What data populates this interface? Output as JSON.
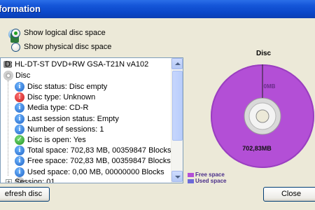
{
  "window": {
    "title": "formation"
  },
  "view_options": [
    {
      "label": "Show logical disc space",
      "checked": true
    },
    {
      "label": "Show physical disc space",
      "checked": false
    }
  ],
  "tree": {
    "drive": "D:  HL-DT-ST  DVD+RW GSA-T21N  vA102",
    "disc": "Disc",
    "items": [
      {
        "icon": "info",
        "text": "Disc status: Disc empty"
      },
      {
        "icon": "warn",
        "text": "Disc type: Unknown"
      },
      {
        "icon": "info",
        "text": "Media type: CD-R"
      },
      {
        "icon": "info",
        "text": "Last session status: Empty"
      },
      {
        "icon": "info",
        "text": "Number of sessions: 1"
      },
      {
        "icon": "ok",
        "text": "Disc is open: Yes"
      },
      {
        "icon": "info",
        "text": "Total space: 702,83 MB, 00359847 Blocks"
      },
      {
        "icon": "info",
        "text": "Free space: 702,83 MB, 00359847 Blocks"
      },
      {
        "icon": "info",
        "text": "Used space: 0,00 MB, 00000000 Blocks"
      }
    ],
    "session": "Session: 01"
  },
  "buttons": {
    "refresh": "efresh disc",
    "close": "Close"
  },
  "chart_data": {
    "type": "pie",
    "title": "Disc",
    "slices": [
      {
        "name": "Free space",
        "value": 702.83,
        "label": "702,83MB",
        "color": "#b34fd6"
      },
      {
        "name": "Used space",
        "value": 0.0,
        "label": "0MB",
        "color": "#6c6ad8"
      }
    ],
    "legend": [
      "Free space",
      "Used space"
    ],
    "legend_position": "bottom-left"
  }
}
